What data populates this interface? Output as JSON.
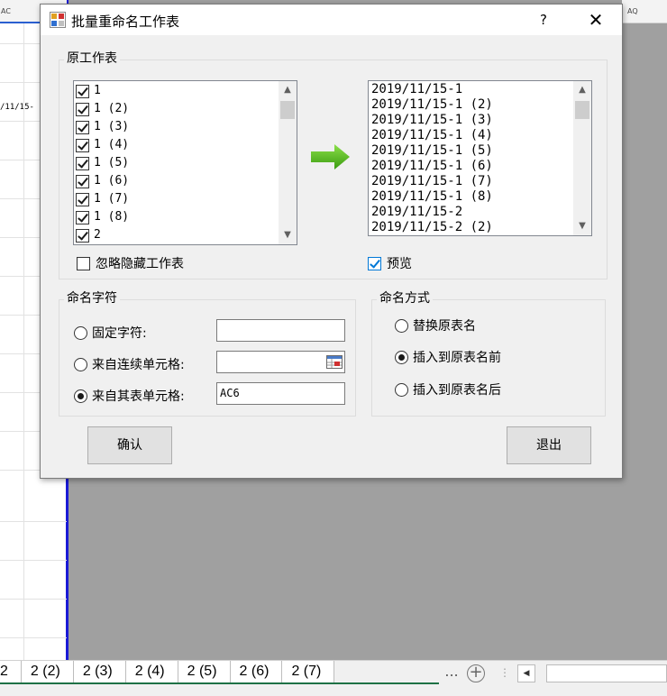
{
  "sheet": {
    "col_header_left": "AC",
    "col_header_right": "AQ",
    "cell_value": "/11/15-",
    "tabs": [
      "2",
      "2 (2)",
      "2 (3)",
      "2 (4)",
      "2 (5)",
      "2 (6)",
      "2 (7)"
    ],
    "more_label": "...",
    "add_label": "+"
  },
  "dialog": {
    "title": "批量重命名工作表",
    "help_label": "?",
    "close_label": "✕",
    "original_group": {
      "legend": "原工作表",
      "sheets": [
        "1",
        "1 (2)",
        "1 (3)",
        "1 (4)",
        "1 (5)",
        "1 (6)",
        "1 (7)",
        "1 (8)",
        "2"
      ],
      "ignore_hidden_label": "忽略隐藏工作表",
      "ignore_hidden_checked": false
    },
    "preview_list": [
      "2019/11/15-1",
      "2019/11/15-1 (2)",
      "2019/11/15-1 (3)",
      "2019/11/15-1 (4)",
      "2019/11/15-1 (5)",
      "2019/11/15-1 (6)",
      "2019/11/15-1 (7)",
      "2019/11/15-1 (8)",
      "2019/11/15-2",
      "2019/11/15-2 (2)"
    ],
    "preview_label": "预览",
    "preview_checked": true,
    "naming_chars": {
      "legend": "命名字符",
      "fixed_label": "固定字符:",
      "fixed_value": "",
      "continuous_label": "来自连续单元格:",
      "continuous_value": "",
      "other_sheet_label": "来自其表单元格:",
      "other_sheet_value": "AC6",
      "selected": "other_sheet"
    },
    "naming_method": {
      "legend": "命名方式",
      "options": [
        "替换原表名",
        "插入到原表名前",
        "插入到原表名后"
      ],
      "selected_index": 1
    },
    "confirm_label": "确认",
    "exit_label": "退出"
  },
  "colors": {
    "arrow": "#4caf1a",
    "accent": "#0078d7",
    "tab_underline": "#1e7145"
  }
}
